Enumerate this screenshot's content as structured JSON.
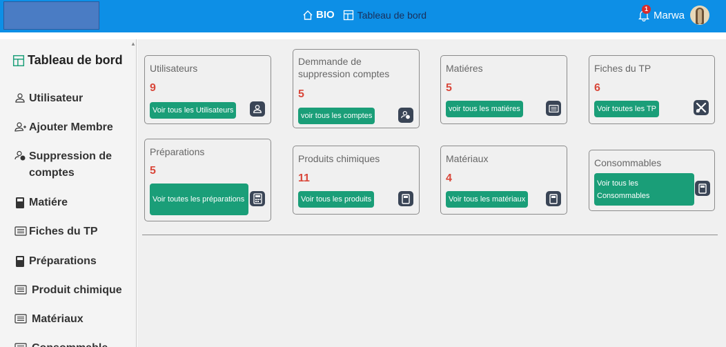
{
  "header": {
    "brand": "BIO",
    "breadcrumb": "Tableau de bord",
    "user_name": "Marwa",
    "notification_count": "1",
    "colors": {
      "bar": "#0d8fe6",
      "badge": "#d92b2b"
    }
  },
  "sidebar": {
    "title": "Tableau de bord",
    "items": [
      {
        "label": "Utilisateur",
        "icon": "user-icon"
      },
      {
        "label": "Ajouter Membre",
        "icon": "user-plus-icon"
      },
      {
        "label": "Suppression de comptes",
        "icon": "user-remove-icon"
      },
      {
        "label": "Matiére",
        "icon": "document-icon"
      },
      {
        "label": "Fiches du TP",
        "icon": "list-icon"
      },
      {
        "label": "Préparations",
        "icon": "document-icon"
      },
      {
        "label": "Produit chimique",
        "icon": "list-icon"
      },
      {
        "label": "Matériaux",
        "icon": "list-icon"
      },
      {
        "label": "Consommable",
        "icon": "list-icon"
      }
    ]
  },
  "cards": [
    {
      "title": "Utilisateurs",
      "count": "9",
      "button": "Voir tous les Utilisateurs",
      "icon": "user-icon"
    },
    {
      "title": "Demmande de suppression comptes",
      "count": "5",
      "button": "voir tous les comptes",
      "icon": "user-remove-icon"
    },
    {
      "title": "Matiéres",
      "count": "5",
      "button": "voir tous les matiéres",
      "icon": "list-icon"
    },
    {
      "title": "Fiches du TP",
      "count": "6",
      "button": "Voir toutes les TP",
      "icon": "tools-icon"
    },
    {
      "title": "Préparations",
      "count": "5",
      "button": "Voir toutes les préparations",
      "icon": "calculator-icon"
    },
    {
      "title": "Produits chimiques",
      "count": "11",
      "button": "Voir tous les produits",
      "icon": "document-icon"
    },
    {
      "title": "Matériaux",
      "count": "4",
      "button": "Voir tous les matériaux",
      "icon": "document-icon"
    },
    {
      "title": "Consommables",
      "count": "",
      "button": "Voir tous les Consommables",
      "icon": "document-icon"
    }
  ],
  "accent": {
    "button": "#1a9e78",
    "count": "#d9473a",
    "icon_bg": "#3a4556"
  }
}
